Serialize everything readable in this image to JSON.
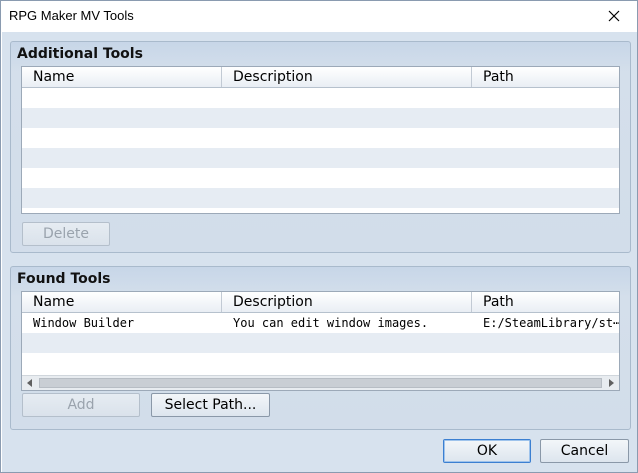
{
  "window": {
    "title": "RPG Maker MV Tools"
  },
  "additional_tools": {
    "title": "Additional Tools",
    "columns": [
      "Name",
      "Description",
      "Path"
    ],
    "delete_label": "Delete"
  },
  "found_tools": {
    "title": "Found Tools",
    "columns": [
      "Name",
      "Description",
      "Path"
    ],
    "rows": [
      {
        "name": "Window Builder",
        "description": "You can edit window images.",
        "path": "E:/SteamLibrary/st⋯"
      }
    ],
    "add_label": "Add",
    "select_path_label": "Select Path..."
  },
  "footer": {
    "ok_label": "OK",
    "cancel_label": "Cancel"
  },
  "icons": {
    "close": "close-icon",
    "scroll_left": "arrow-left-icon",
    "scroll_right": "arrow-right-icon"
  }
}
